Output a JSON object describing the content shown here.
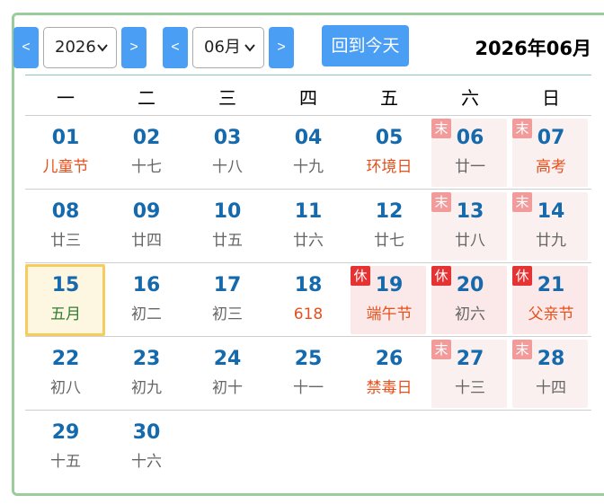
{
  "controls": {
    "prev_year_label": "<",
    "year_value": "2026",
    "next_year_label": ">",
    "prev_month_label": "<",
    "month_value": "06月",
    "next_month_label": ">",
    "today_label": "回到今天"
  },
  "title": "2026年06月",
  "weekdays": [
    "一",
    "二",
    "三",
    "四",
    "五",
    "六",
    "日"
  ],
  "weeks": [
    [
      {
        "day": "01",
        "sub": "儿童节",
        "festival": true
      },
      {
        "day": "02",
        "sub": "十七"
      },
      {
        "day": "03",
        "sub": "十八"
      },
      {
        "day": "04",
        "sub": "十九"
      },
      {
        "day": "05",
        "sub": "环境日",
        "festival": true
      },
      {
        "day": "06",
        "sub": "廿一",
        "tag": "末",
        "kind": "weekend"
      },
      {
        "day": "07",
        "sub": "高考",
        "festival": true,
        "tag": "末",
        "kind": "weekend"
      }
    ],
    [
      {
        "day": "08",
        "sub": "廿三"
      },
      {
        "day": "09",
        "sub": "廿四"
      },
      {
        "day": "10",
        "sub": "廿五"
      },
      {
        "day": "11",
        "sub": "廿六"
      },
      {
        "day": "12",
        "sub": "廿七"
      },
      {
        "day": "13",
        "sub": "廿八",
        "tag": "末",
        "kind": "weekend"
      },
      {
        "day": "14",
        "sub": "廿九",
        "tag": "末",
        "kind": "weekend"
      }
    ],
    [
      {
        "day": "15",
        "sub": "五月",
        "kind": "today"
      },
      {
        "day": "16",
        "sub": "初二"
      },
      {
        "day": "17",
        "sub": "初三"
      },
      {
        "day": "18",
        "sub": "618",
        "festival": true
      },
      {
        "day": "19",
        "sub": "端午节",
        "festival": true,
        "tag": "休",
        "kind": "holiday"
      },
      {
        "day": "20",
        "sub": "初六",
        "tag": "休",
        "kind": "holiday"
      },
      {
        "day": "21",
        "sub": "父亲节",
        "festival": true,
        "tag": "休",
        "kind": "holiday"
      }
    ],
    [
      {
        "day": "22",
        "sub": "初八"
      },
      {
        "day": "23",
        "sub": "初九"
      },
      {
        "day": "24",
        "sub": "初十"
      },
      {
        "day": "25",
        "sub": "十一"
      },
      {
        "day": "26",
        "sub": "禁毒日",
        "festival": true
      },
      {
        "day": "27",
        "sub": "十三",
        "tag": "末",
        "kind": "weekend"
      },
      {
        "day": "28",
        "sub": "十四",
        "tag": "末",
        "kind": "weekend"
      }
    ],
    [
      {
        "day": "29",
        "sub": "十五"
      },
      {
        "day": "30",
        "sub": "十六"
      }
    ]
  ],
  "colors": {
    "accent": "#4a9ff5",
    "day_number": "#1569ad",
    "festival_text": "#e4511c",
    "today_border": "#f6cd5c",
    "rest_tag": "#e53232",
    "weekend_tag": "#f29b9b"
  }
}
